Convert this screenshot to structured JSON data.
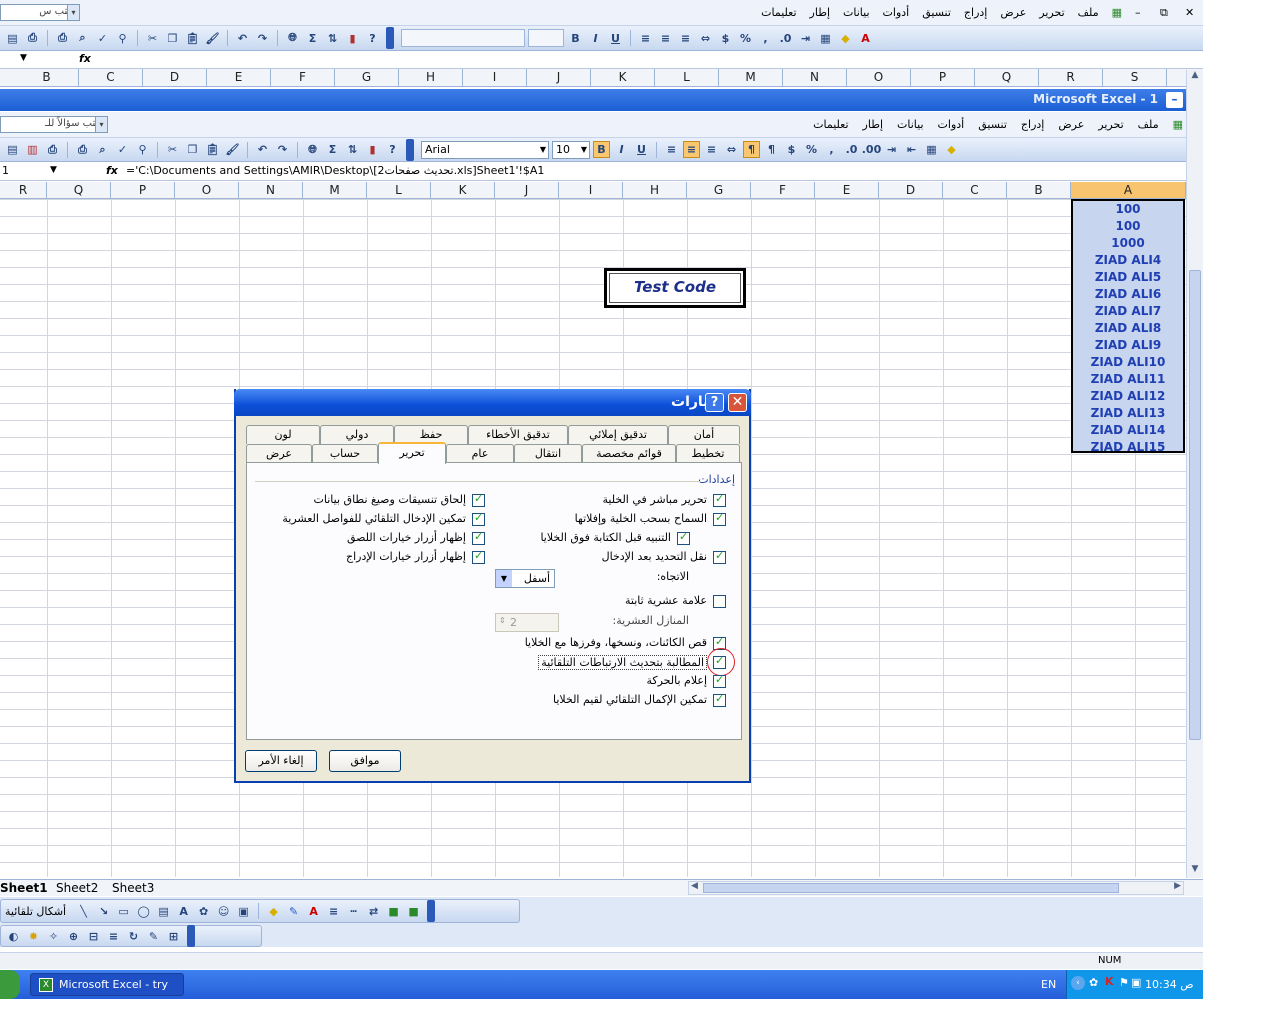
{
  "outer_menu": {
    "items": [
      "ملف",
      "تحرير",
      "عرض",
      "إدراج",
      "تنسيق",
      "أدوات",
      "بيانات",
      "إطار",
      "تعليمات"
    ],
    "question_box": "اكتب س"
  },
  "outer_window_controls": {
    "min": "–",
    "restore": "⧉",
    "close": "✕"
  },
  "outer_colheaders": [
    "B",
    "C",
    "D",
    "E",
    "F",
    "G",
    "H",
    "I",
    "J",
    "K",
    "L",
    "M",
    "N",
    "O",
    "P",
    "Q",
    "R",
    "S"
  ],
  "inner_title": "Microsoft Excel - 1",
  "inner_menu": {
    "items": [
      "ملف",
      "تحرير",
      "عرض",
      "إدراج",
      "تنسيق",
      "أدوات",
      "بيانات",
      "إطار",
      "تعليمات"
    ],
    "question_box": "اكتب سؤالاً للـ"
  },
  "format_toolbar": {
    "font": "Arial",
    "size": "10"
  },
  "name_box": "1",
  "formula": "='C:\\Documents and Settings\\AMIR\\Desktop\\[تحديث صفحات2.xls]Sheet1'!$A1",
  "inner_colheaders": [
    "R",
    "Q",
    "P",
    "O",
    "N",
    "M",
    "L",
    "K",
    "J",
    "I",
    "H",
    "G",
    "F",
    "E",
    "D",
    "C",
    "B",
    "A"
  ],
  "column_a": [
    "100",
    "100",
    "1000",
    "ZIAD ALI4",
    "ZIAD ALI5",
    "ZIAD ALI6",
    "ZIAD ALI7",
    "ZIAD ALI8",
    "ZIAD ALI9",
    "ZIAD ALI10",
    "ZIAD ALI11",
    "ZIAD ALI12",
    "ZIAD ALI13",
    "ZIAD ALI14",
    "ZIAD ALI15"
  ],
  "test_button": "Test Code",
  "dialog": {
    "title": "خيارات",
    "tabs_row1": [
      "أمان",
      "تدقيق إملائي",
      "تدقيق الأخطاء",
      "حفظ",
      "دولي",
      "لون"
    ],
    "tabs_row2": [
      "تخطيط",
      "قوائم مخصصة",
      "انتقال",
      "عام",
      "تحرير",
      "حساب",
      "عرض"
    ],
    "section": "إعدادات",
    "right_options": [
      "تحرير مباشر في الخلية",
      "السماح بسحب الخلية وإفلاتها",
      "التنبيه قبل الكتابة فوق الخلايا",
      "نقل التحديد بعد الإدخال"
    ],
    "direction_label": "الاتجاه:",
    "direction_value": "أسفل",
    "fixed_decimal": "علامة عشرية ثابتة",
    "decimal_places_label": "المنازل العشرية:",
    "decimal_places_value": "2",
    "bottom_options": [
      "قص الكائنات، ونسخها، وفرزها مع الخلايا",
      "المطالبة بتحديث الارتباطات التلقائية",
      "إعلام بالحركة",
      "تمكين الإكمال التلقائي لقيم الخلايا"
    ],
    "left_options": [
      "إلحاق تنسيقات وصيغ نطاق بيانات",
      "تمكين الإدخال التلقائي للفواصل العشرية",
      "إظهار أزرار خيارات اللصق",
      "إظهار أزرار خيارات الإدراج"
    ],
    "ok": "موافق",
    "cancel": "إلغاء الأمر"
  },
  "sheet_tabs": [
    "Sheet1",
    "Sheet2",
    "Sheet3"
  ],
  "draw_label": "أشكال تلقائية",
  "status": {
    "num": "NUM"
  },
  "taskbar": {
    "app": "Microsoft Excel - try",
    "lang": "EN",
    "time": "10:34 ص"
  }
}
